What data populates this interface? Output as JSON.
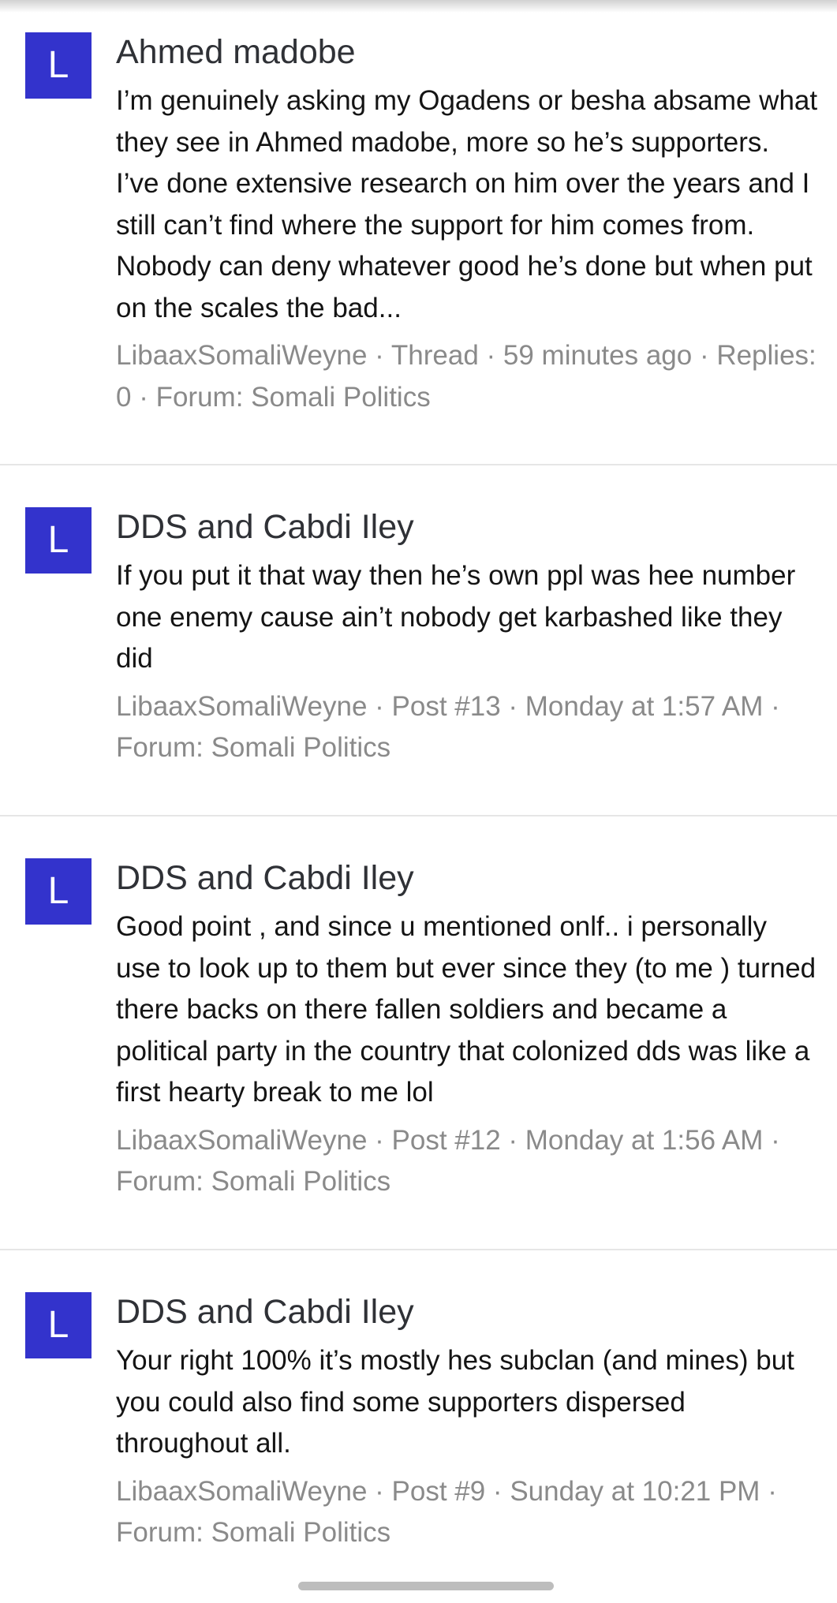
{
  "results": [
    {
      "avatar_letter": "L",
      "title": "Ahmed madobe",
      "snippet": "I’m genuinely asking my Ogadens or besha absame what they see in Ahmed madobe, more so he’s supporters. I’ve done extensive research on him over the years and I still can’t find where the support for him comes from. Nobody can deny whatever good he’s done but when put on the scales the bad...",
      "meta": "LibaaxSomaliWeyne · Thread · 59 minutes ago · Replies: 0 · Forum: Somali Politics"
    },
    {
      "avatar_letter": "L",
      "title": "DDS and Cabdi Iley",
      "snippet": "If you put it that way then he’s own ppl was hee number one enemy cause ain’t nobody get karbashed like they did",
      "meta": "LibaaxSomaliWeyne · Post #13 · Monday at 1:57 AM · Forum: Somali Politics"
    },
    {
      "avatar_letter": "L",
      "title": "DDS and Cabdi Iley",
      "snippet": "Good point , and since u mentioned onlf.. i personally use to look up to them but ever since they (to me ) turned there backs on there fallen soldiers and became a political party in the country that colonized dds was like a first hearty break to me lol",
      "meta": "LibaaxSomaliWeyne · Post #12 · Monday at 1:56 AM · Forum: Somali Politics"
    },
    {
      "avatar_letter": "L",
      "title": "DDS and Cabdi Iley",
      "snippet": "Your right 100% it’s mostly hes subclan (and mines) but you could also find some supporters dispersed throughout all.",
      "meta": "LibaaxSomaliWeyne · Post #9 · Sunday at 10:21 PM · Forum: Somali Politics"
    }
  ],
  "colors": {
    "avatar_bg": "#3333cc",
    "title": "#2f3136",
    "snippet": "#141414",
    "meta": "#8a8a8a",
    "divider": "#e6e6e6"
  }
}
